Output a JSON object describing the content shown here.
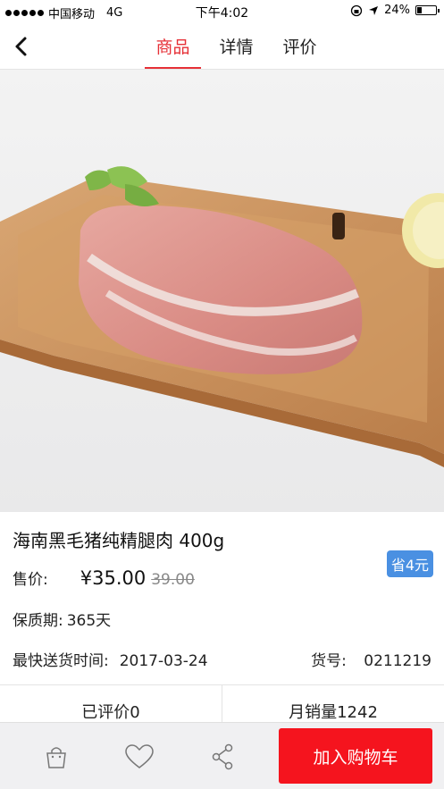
{
  "status_bar": {
    "carrier": "中国移动",
    "network": "4G",
    "time": "下午4:02",
    "battery": "24%",
    "battery_level": 0.24
  },
  "nav": {
    "tabs": [
      {
        "label": "商品",
        "active": true
      },
      {
        "label": "详情",
        "active": false
      },
      {
        "label": "评价",
        "active": false
      }
    ],
    "accent_color": "#e63037"
  },
  "gallery": {
    "page_count": 3,
    "current_page": 1
  },
  "product": {
    "title": "海南黑毛猪纯精腿肉 400g",
    "price_label": "售价:",
    "price": "¥35.00",
    "original_price": "39.00",
    "save_badge": "省4元",
    "shelf_life_label": "保质期:",
    "shelf_life": "365天",
    "ship_label": "最快送货时间:",
    "ship_date": "2017-03-24",
    "sku_label": "货号:",
    "sku": "0211219"
  },
  "stats": {
    "reviewed": "已评价0",
    "monthly_sales": "月销量1242"
  },
  "bottom_bar": {
    "add_to_cart": "加入购物车",
    "cart_color": "#f5141e"
  }
}
